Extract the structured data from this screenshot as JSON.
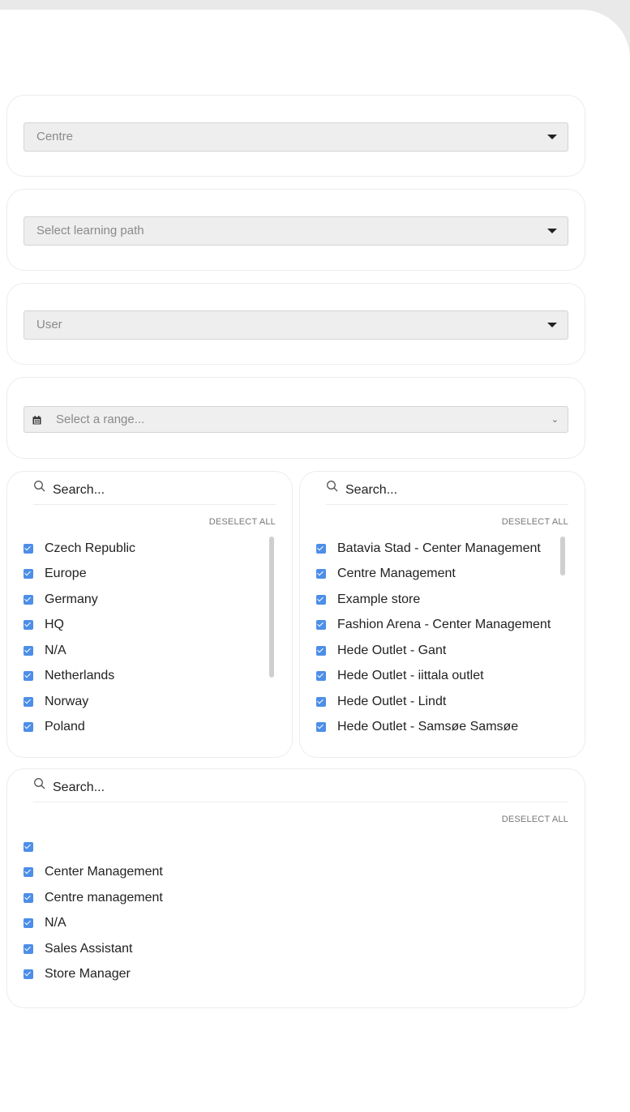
{
  "filters": {
    "centre_placeholder": "Centre",
    "learning_path_placeholder": "Select learning path",
    "user_placeholder": "User",
    "date_range_placeholder": "Select a range..."
  },
  "countries": {
    "search_placeholder": "Search...",
    "deselect_label": "DESELECT ALL",
    "items": [
      "Czech Republic",
      "Europe",
      "Germany",
      "HQ",
      "N/A",
      "Netherlands",
      "Norway",
      "Poland"
    ]
  },
  "stores": {
    "search_placeholder": "Search...",
    "deselect_label": "DESELECT ALL",
    "items": [
      "Batavia Stad - Center Management",
      "Centre Management",
      "Example store",
      "Fashion Arena - Center Management",
      "Hede Outlet - Gant",
      "Hede Outlet - iittala outlet",
      "Hede Outlet - Lindt",
      "Hede Outlet - Samsøe Samsøe"
    ]
  },
  "roles": {
    "search_placeholder": "Search...",
    "deselect_label": "DESELECT ALL",
    "items": [
      "",
      "Center Management",
      "Centre management",
      "N/A",
      "Sales Assistant",
      "Store Manager"
    ]
  },
  "colors": {
    "checkbox": "#4d8ee8",
    "background": "#e9e9e9"
  },
  "icons": {
    "search": "search-icon",
    "calendar": "calendar-icon",
    "dropdown": "caret-down-icon"
  }
}
